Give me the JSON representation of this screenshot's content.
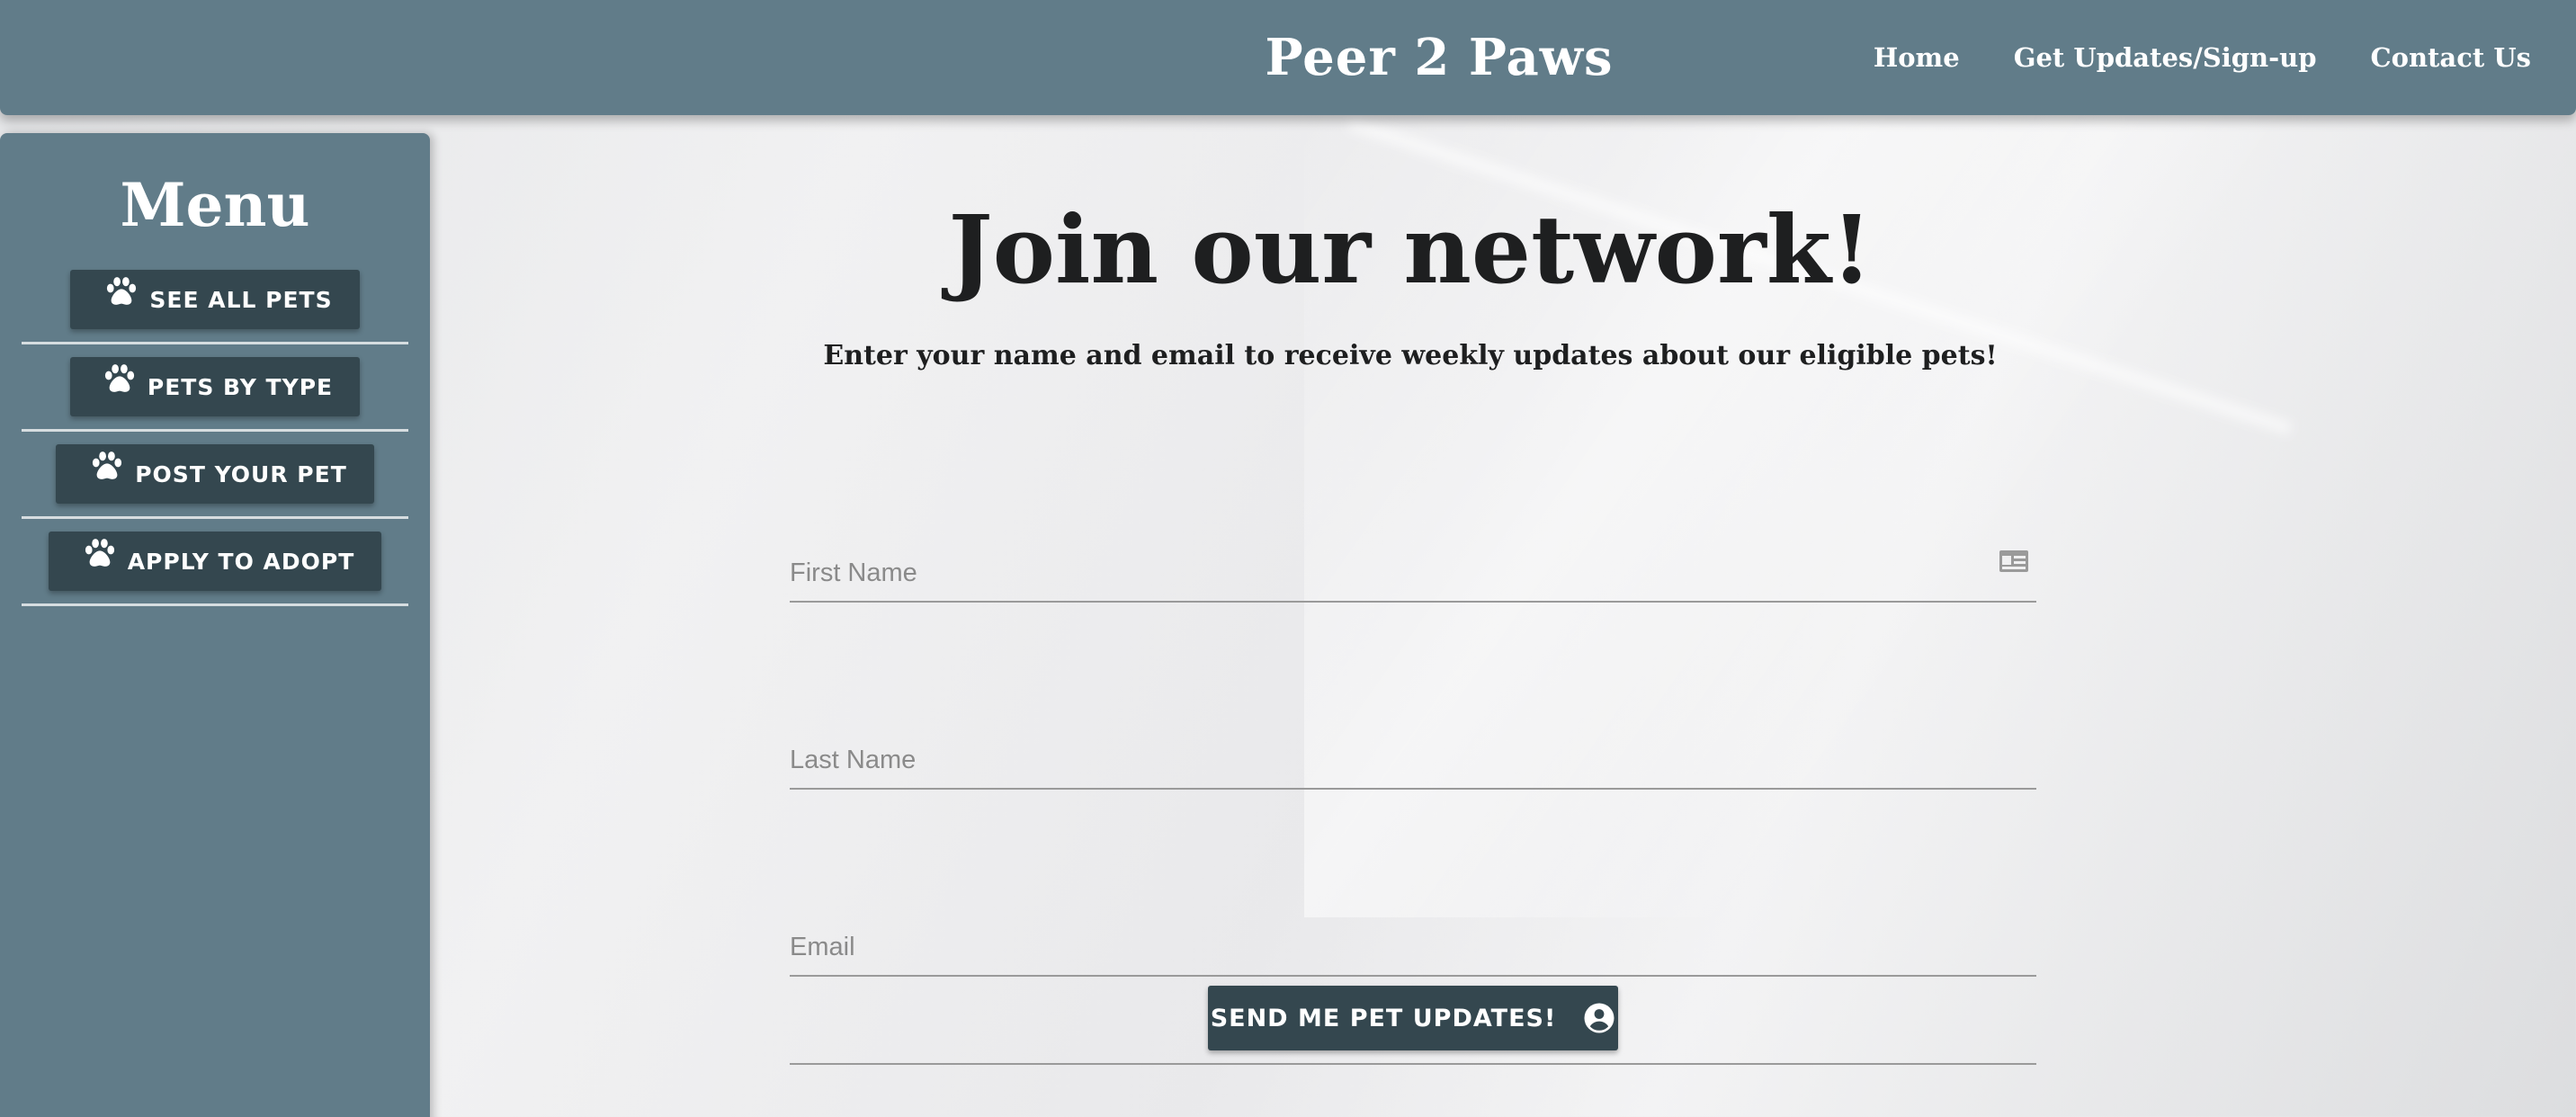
{
  "header": {
    "brand": "Peer 2 Paws",
    "nav": [
      {
        "label": "Home"
      },
      {
        "label": "Get Updates/Sign-up"
      },
      {
        "label": "Contact Us"
      }
    ]
  },
  "sidebar": {
    "title": "Menu",
    "items": [
      {
        "label": "SEE ALL PETS",
        "icon": "paw-icon"
      },
      {
        "label": "PETS BY TYPE",
        "icon": "paw-icon"
      },
      {
        "label": "POST YOUR PET",
        "icon": "paw-icon"
      },
      {
        "label": "APPLY TO ADOPT",
        "icon": "paw-icon"
      }
    ]
  },
  "main": {
    "title": "Join our network!",
    "subtitle": "Enter your name and email to receive weekly updates about our eligible pets!",
    "form": {
      "first_name": {
        "placeholder": "First Name",
        "value": "",
        "icon": "id-card-icon"
      },
      "last_name": {
        "placeholder": "Last Name",
        "value": ""
      },
      "email": {
        "placeholder": "Email",
        "value": ""
      },
      "submit_label": "SEND ME PET UPDATES!",
      "submit_icon": "account-circle-icon"
    }
  },
  "colors": {
    "bar": "#617c89",
    "button": "#34474f",
    "text": "#1e1f20"
  }
}
